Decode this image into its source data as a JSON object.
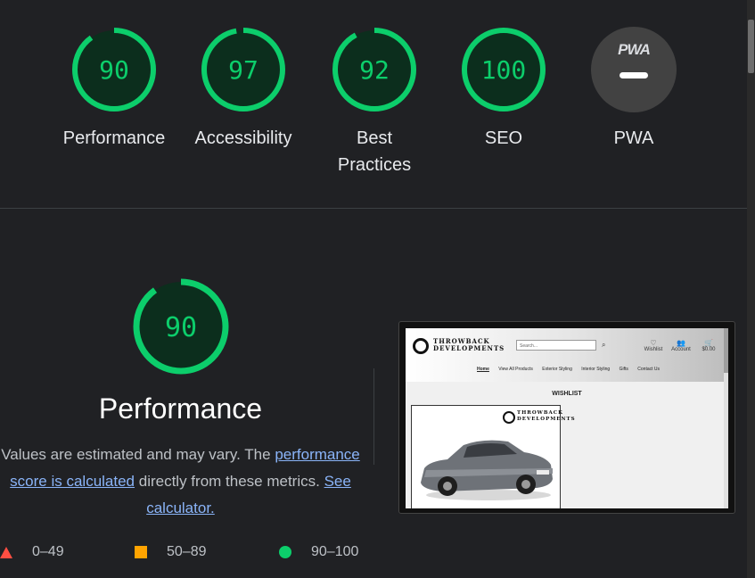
{
  "colors": {
    "pass": "#0cce6b",
    "average": "#ffa400",
    "fail": "#ff4e42",
    "link": "#8ab4f8"
  },
  "gauges": [
    {
      "score": "90",
      "label": "Performance"
    },
    {
      "score": "97",
      "label": "Accessibility"
    },
    {
      "score": "92",
      "label": "Best Practices"
    },
    {
      "score": "100",
      "label": "SEO"
    }
  ],
  "pwa": {
    "badge": "PWA",
    "label": "PWA"
  },
  "performance": {
    "score": "90",
    "title": "Performance",
    "desc_prefix": "Values are estimated and may vary. The ",
    "desc_link": "performance score is calculated",
    "desc_middle": " directly from these metrics. ",
    "calc_link": "See calculator."
  },
  "legend": {
    "fail": "0–49",
    "average": "50–89",
    "pass": "90–100"
  },
  "site_screenshot": {
    "logo_line1": "THROWBACK",
    "logo_line2": "DEVELOPMENTS",
    "search_placeholder": "Search...",
    "wishlist_icon_label": "Wishlist",
    "account_icon_label": "Account",
    "cart_total": "$0.00",
    "nav": [
      "Home",
      "View All Products",
      "Exterior Styling",
      "Interior Styling",
      "Gifts",
      "Contact Us"
    ],
    "heading": "WISHLIST"
  }
}
